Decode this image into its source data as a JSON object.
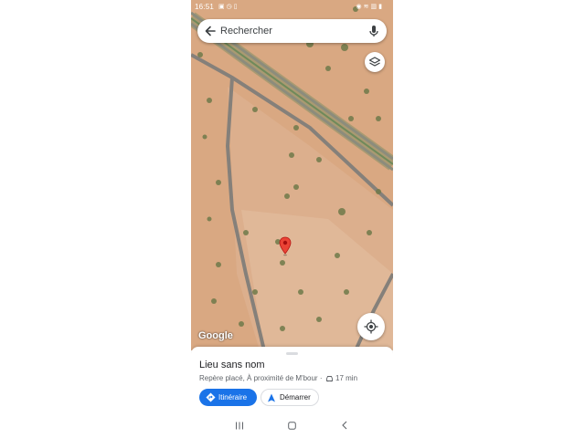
{
  "status_bar": {
    "time": "16:51"
  },
  "search": {
    "placeholder": "Rechercher",
    "value": ""
  },
  "map": {
    "attribution": "Google",
    "pin_color": "#ea4335"
  },
  "place": {
    "title": "Lieu sans nom",
    "subtitle": "Repère placé, À proximité de M'bour ·",
    "travel_time": "17 min"
  },
  "actions": {
    "directions_label": "Itinéraire",
    "start_label": "Démarrer"
  },
  "colors": {
    "accent": "#1a73e8",
    "sand": "#d9a882",
    "road": "#8b8680"
  },
  "icons": [
    "back-arrow-icon",
    "mic-icon",
    "layers-icon",
    "my-location-icon",
    "map-pin-icon",
    "car-icon",
    "directions-icon",
    "navigation-arrow-icon",
    "recents-icon",
    "home-icon",
    "back-icon"
  ]
}
